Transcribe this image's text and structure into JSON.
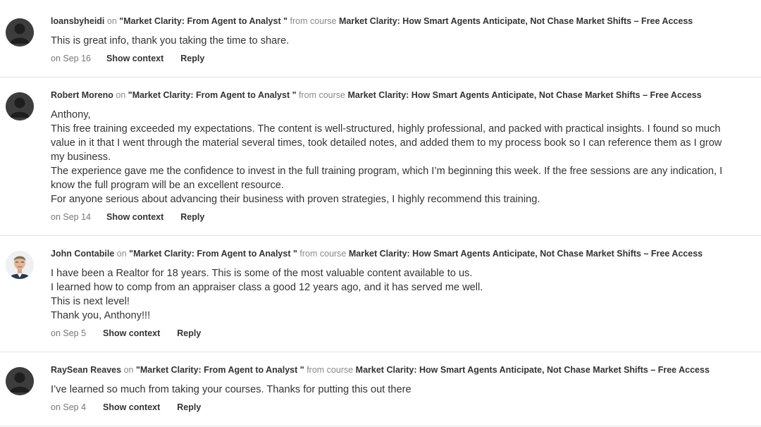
{
  "labels": {
    "on": "on",
    "from_course": "from course",
    "show_context": "Show context",
    "reply": "Reply"
  },
  "comments": [
    {
      "author": "loansbyheidi",
      "lesson": "\"Market Clarity: From Agent to Analyst \"",
      "course": "Market Clarity: How Smart Agents Anticipate, Not Chase Market Shifts – Free Access",
      "paragraphs": [
        "This is great info, thank you taking the time to share."
      ],
      "date": "on Sep 16",
      "avatar": "default-user-icon"
    },
    {
      "author": "Robert Moreno",
      "lesson": "\"Market Clarity: From Agent to Analyst \"",
      "course": "Market Clarity: How Smart Agents Anticipate, Not Chase Market Shifts – Free Access",
      "paragraphs": [
        "Anthony,",
        "This free training exceeded my expectations. The content is well-structured, highly professional, and packed with practical insights. I found so much value in it that I went through the material several times, took detailed notes, and added them to my process book so I can reference them as I grow my business.",
        "The experience gave me the confidence to invest in the full training program, which I’m beginning this week. If the free sessions are any indication, I know the full program will be an excellent resource.",
        "For anyone serious about advancing their business with proven strategies, I highly recommend this training."
      ],
      "date": "on Sep 14",
      "avatar": "default-user-icon"
    },
    {
      "author": "John Contabile",
      "lesson": "\"Market Clarity: From Agent to Analyst \"",
      "course": "Market Clarity: How Smart Agents Anticipate, Not Chase Market Shifts – Free Access",
      "paragraphs": [
        "I have been a Realtor for 18 years. This is some of the most valuable content available to us.",
        "I learned how to comp from an appraiser class a good 12 years ago, and it has served me well.",
        "This is next level!",
        "Thank you, Anthony!!!"
      ],
      "date": "on Sep 5",
      "avatar": "profile-photo"
    },
    {
      "author": "RaySean Reaves",
      "lesson": "\"Market Clarity: From Agent to Analyst \"",
      "course": "Market Clarity: How Smart Agents Anticipate, Not Chase Market Shifts – Free Access",
      "paragraphs": [
        "I’ve learned so much from taking your courses. Thanks for putting this out there"
      ],
      "date": "on Sep 4",
      "avatar": "default-user-icon"
    }
  ],
  "colors": {
    "text": "#333333",
    "muted": "#8a8a8a",
    "divider": "#e3e3e3",
    "avatar_bg": "#3a3a3a"
  }
}
